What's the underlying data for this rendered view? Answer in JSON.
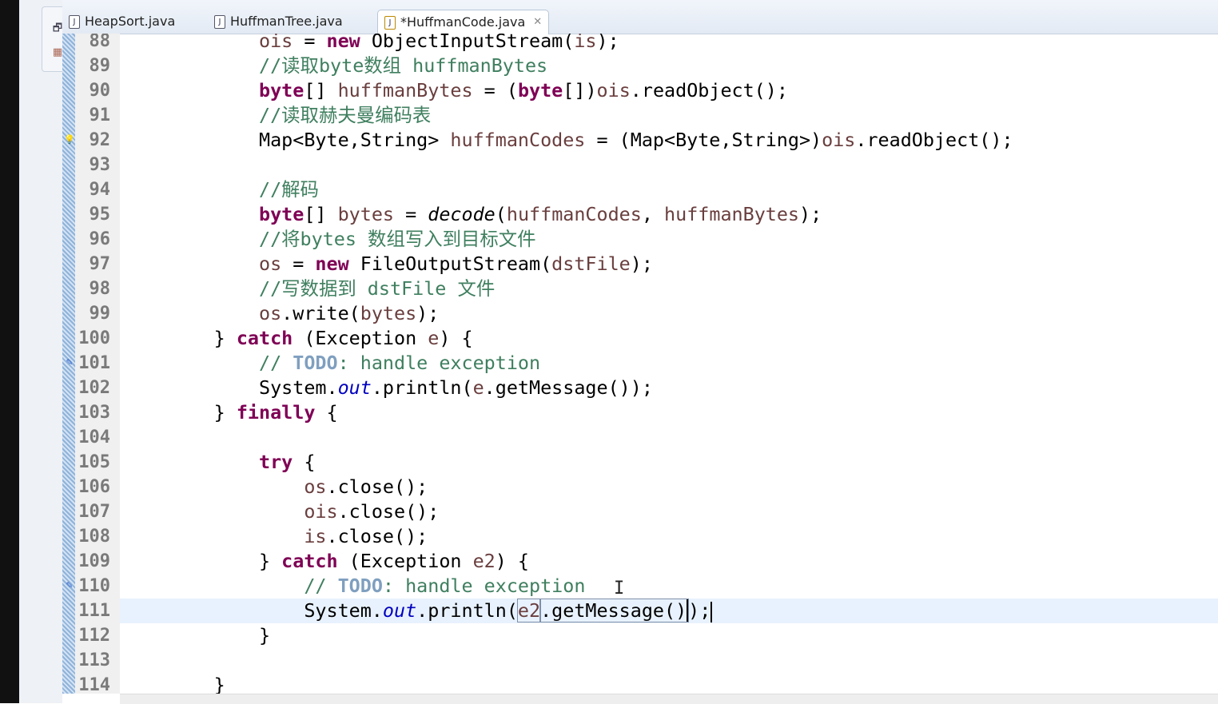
{
  "tabs": [
    {
      "label": "HeapSort.java",
      "active": false
    },
    {
      "label": "HuffmanTree.java",
      "active": false
    },
    {
      "label": "*HuffmanCode.java",
      "active": true
    }
  ],
  "colors": {
    "keyword": "#7f0055",
    "variable": "#6a3e3e",
    "comment": "#3f7f5f",
    "todo": "#7f9fbf",
    "field": "#0000c0",
    "current_line": "#e8f2fe"
  },
  "editor": {
    "current_line": 111,
    "lines": [
      {
        "n": 88,
        "tokens": [
          [
            "            ",
            "p"
          ],
          [
            "ois",
            "v"
          ],
          [
            " = ",
            "p"
          ],
          [
            "new",
            "k"
          ],
          [
            " ObjectInputStream(",
            "p"
          ],
          [
            "is",
            "v"
          ],
          [
            ");",
            "p"
          ]
        ]
      },
      {
        "n": 89,
        "tokens": [
          [
            "            ",
            "p"
          ],
          [
            "//读取byte数组 huffmanBytes",
            "c"
          ]
        ]
      },
      {
        "n": 90,
        "tokens": [
          [
            "            ",
            "p"
          ],
          [
            "byte",
            "k"
          ],
          [
            "[] ",
            "p"
          ],
          [
            "huffmanBytes",
            "v"
          ],
          [
            " = (",
            "p"
          ],
          [
            "byte",
            "k"
          ],
          [
            "[])",
            "p"
          ],
          [
            "ois",
            "v"
          ],
          [
            ".readObject();",
            "p"
          ]
        ]
      },
      {
        "n": 91,
        "tokens": [
          [
            "            ",
            "p"
          ],
          [
            "//读取赫夫曼编码表",
            "c"
          ]
        ]
      },
      {
        "n": 92,
        "marker": "warning",
        "tokens": [
          [
            "            ",
            "p"
          ],
          [
            "Map<Byte,String> ",
            "p"
          ],
          [
            "huffmanCodes",
            "v"
          ],
          [
            " = (Map<Byte,String>)",
            "p"
          ],
          [
            "ois",
            "v"
          ],
          [
            ".readObject();",
            "p"
          ]
        ]
      },
      {
        "n": 93,
        "tokens": []
      },
      {
        "n": 94,
        "tokens": [
          [
            "            ",
            "p"
          ],
          [
            "//解码",
            "c"
          ]
        ]
      },
      {
        "n": 95,
        "tokens": [
          [
            "            ",
            "p"
          ],
          [
            "byte",
            "k"
          ],
          [
            "[] ",
            "p"
          ],
          [
            "bytes",
            "v"
          ],
          [
            " = ",
            "p"
          ],
          [
            "decode",
            "i"
          ],
          [
            "(",
            "p"
          ],
          [
            "huffmanCodes",
            "v"
          ],
          [
            ", ",
            "p"
          ],
          [
            "huffmanBytes",
            "v"
          ],
          [
            ");",
            "p"
          ]
        ]
      },
      {
        "n": 96,
        "tokens": [
          [
            "            ",
            "p"
          ],
          [
            "//将bytes 数组写入到目标文件",
            "c"
          ]
        ]
      },
      {
        "n": 97,
        "tokens": [
          [
            "            ",
            "p"
          ],
          [
            "os",
            "v"
          ],
          [
            " = ",
            "p"
          ],
          [
            "new",
            "k"
          ],
          [
            " FileOutputStream(",
            "p"
          ],
          [
            "dstFile",
            "v"
          ],
          [
            ");",
            "p"
          ]
        ]
      },
      {
        "n": 98,
        "tokens": [
          [
            "            ",
            "p"
          ],
          [
            "//写数据到 dstFile 文件",
            "c"
          ]
        ]
      },
      {
        "n": 99,
        "tokens": [
          [
            "            ",
            "p"
          ],
          [
            "os",
            "v"
          ],
          [
            ".write(",
            "p"
          ],
          [
            "bytes",
            "v"
          ],
          [
            ");",
            "p"
          ]
        ]
      },
      {
        "n": 100,
        "tokens": [
          [
            "        } ",
            "p"
          ],
          [
            "catch",
            "k"
          ],
          [
            " (Exception ",
            "p"
          ],
          [
            "e",
            "v"
          ],
          [
            ") {",
            "p"
          ]
        ]
      },
      {
        "n": 101,
        "marker": "task",
        "tokens": [
          [
            "            ",
            "p"
          ],
          [
            "// ",
            "c"
          ],
          [
            "TODO",
            "t"
          ],
          [
            ": handle exception",
            "c"
          ]
        ]
      },
      {
        "n": 102,
        "tokens": [
          [
            "            System.",
            "p"
          ],
          [
            "out",
            "f"
          ],
          [
            ".println(",
            "p"
          ],
          [
            "e",
            "v"
          ],
          [
            ".getMessage());",
            "p"
          ]
        ]
      },
      {
        "n": 103,
        "tokens": [
          [
            "        } ",
            "p"
          ],
          [
            "finally",
            "k"
          ],
          [
            " {",
            "p"
          ]
        ]
      },
      {
        "n": 104,
        "tokens": []
      },
      {
        "n": 105,
        "tokens": [
          [
            "            ",
            "p"
          ],
          [
            "try",
            "k"
          ],
          [
            " {",
            "p"
          ]
        ]
      },
      {
        "n": 106,
        "tokens": [
          [
            "                ",
            "p"
          ],
          [
            "os",
            "v"
          ],
          [
            ".close();",
            "p"
          ]
        ]
      },
      {
        "n": 107,
        "tokens": [
          [
            "                ",
            "p"
          ],
          [
            "ois",
            "v"
          ],
          [
            ".close();",
            "p"
          ]
        ]
      },
      {
        "n": 108,
        "tokens": [
          [
            "                ",
            "p"
          ],
          [
            "is",
            "v"
          ],
          [
            ".close();",
            "p"
          ]
        ]
      },
      {
        "n": 109,
        "tokens": [
          [
            "            } ",
            "p"
          ],
          [
            "catch",
            "k"
          ],
          [
            " (Exception ",
            "p"
          ],
          [
            "e2",
            "v"
          ],
          [
            ") {",
            "p"
          ]
        ]
      },
      {
        "n": 110,
        "marker": "task",
        "tokens": [
          [
            "                ",
            "p"
          ],
          [
            "// ",
            "c"
          ],
          [
            "TODO",
            "t"
          ],
          [
            ": handle exception",
            "c"
          ]
        ]
      },
      {
        "n": 111,
        "tokens": [
          [
            "                System.",
            "p"
          ],
          [
            "out",
            "f"
          ],
          [
            ".println(",
            "p"
          ],
          [
            "e2",
            "v box"
          ],
          [
            ".getMessage()",
            "p box caret"
          ],
          [
            ");",
            "p"
          ]
        ]
      },
      {
        "n": 112,
        "tokens": [
          [
            "            }",
            "p"
          ]
        ]
      },
      {
        "n": 113,
        "tokens": []
      },
      {
        "n": 114,
        "tokens": [
          [
            "        }",
            "p"
          ]
        ]
      }
    ]
  }
}
